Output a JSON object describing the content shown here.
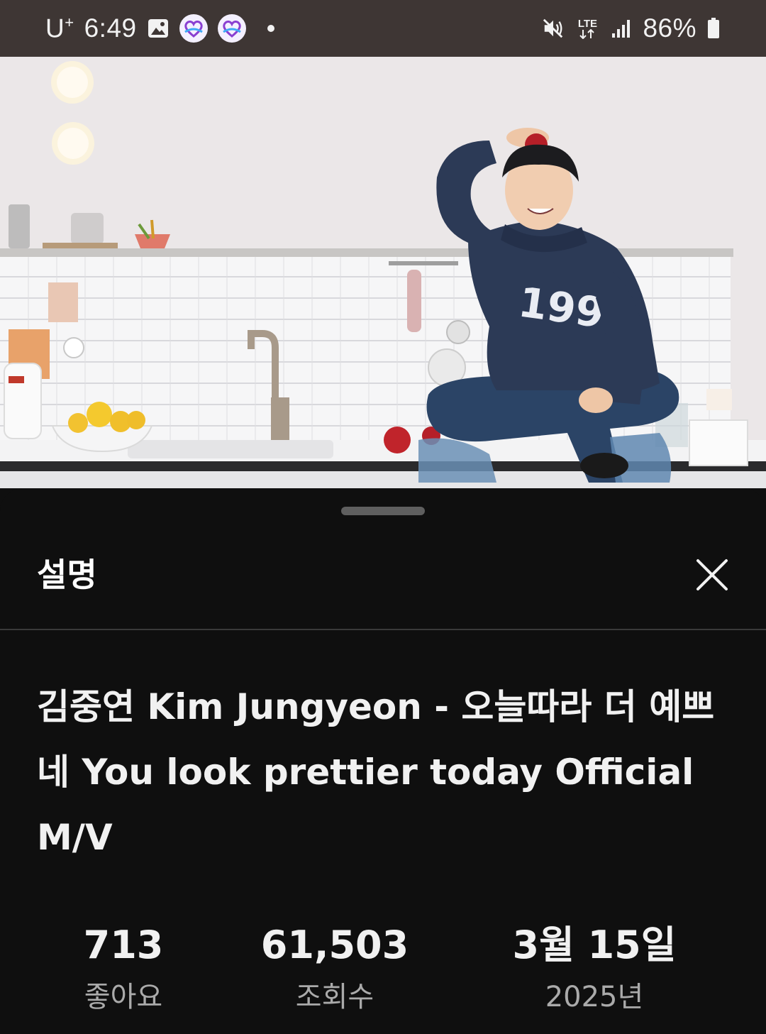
{
  "status_bar": {
    "carrier": "U",
    "carrier_sup": "+",
    "time": "6:49",
    "network": "LTE",
    "battery": "86%",
    "icons": [
      "gallery-icon",
      "app-heart-icon",
      "app-heart-icon",
      "notification-dot",
      "mute-icon",
      "lte-icon",
      "signal-icon",
      "battery-icon"
    ]
  },
  "video": {
    "thumbnail_desc_icon": "video-frame",
    "sweater_text": "1992"
  },
  "sheet": {
    "title": "설명",
    "close_icon": "close-icon",
    "video_title": "김중연 Kim Jungyeon - 오늘따라 더 예쁘네 You look prettier today Official M/V",
    "stats": {
      "likes_value": "713",
      "likes_label": "좋아요",
      "views_value": "61,503",
      "views_label": "조회수",
      "date_value": "3월 15일",
      "date_label": "2025년"
    }
  },
  "colors": {
    "status_bar_bg": "#3e3634",
    "sheet_bg": "#0f0f0f",
    "secondary_text": "#aaaaaa",
    "divider": "#3a3a3a"
  }
}
